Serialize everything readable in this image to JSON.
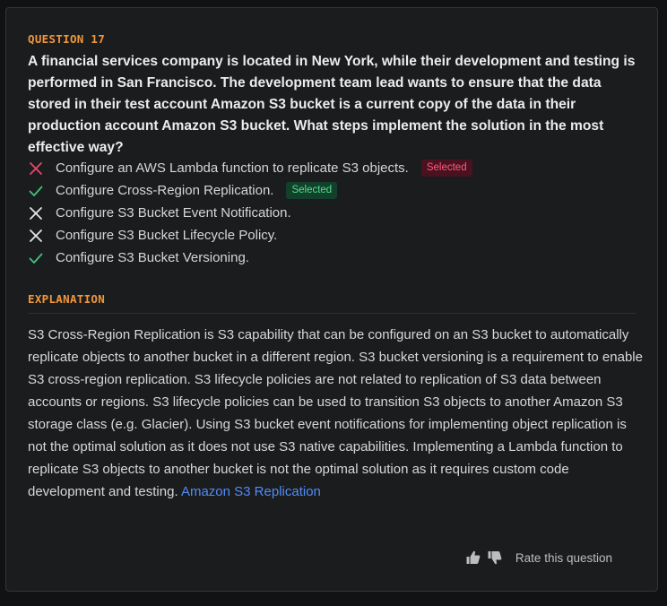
{
  "question": {
    "label": "QUESTION 17",
    "text": "A financial services company is located in New York, while their development and testing is performed in San Francisco. The development team lead wants to ensure that the data stored in their test account Amazon S3 bucket is a current copy of the data in their production account Amazon S3 bucket. What steps implement the solution in the most effective way?"
  },
  "answers": [
    {
      "text": "Configure an AWS Lambda function to replicate S3 objects.",
      "mark": "x-icon",
      "mark_color": "#e5486b",
      "badge": "Selected",
      "badge_type": "wrong"
    },
    {
      "text": "Configure Cross-Region Replication.",
      "mark": "check-icon",
      "mark_color": "#3ec77a",
      "badge": "Selected",
      "badge_type": "right"
    },
    {
      "text": "Configure S3 Bucket Event Notification.",
      "mark": "x-icon",
      "mark_color": "#e6e6e6",
      "badge": "",
      "badge_type": ""
    },
    {
      "text": "Configure S3 Bucket Lifecycle Policy.",
      "mark": "x-icon",
      "mark_color": "#e6e6e6",
      "badge": "",
      "badge_type": ""
    },
    {
      "text": "Configure S3 Bucket Versioning.",
      "mark": "check-icon",
      "mark_color": "#3ec77a",
      "badge": "",
      "badge_type": ""
    }
  ],
  "explanation": {
    "label": "EXPLANATION",
    "text": "S3 Cross-Region Replication is S3 capability that can be configured on an S3 bucket to automatically replicate objects to another bucket in a different region. S3 bucket versioning is a requirement to enable S3 cross-region replication. S3 lifecycle policies are not related to replication of S3 data between accounts or regions. S3 lifecycle policies can be used to transition S3 objects to another Amazon S3 storage class (e.g. Glacier). Using S3 bucket event notifications for implementing object replication is not the optimal solution as it does not use S3 native capabilities. Implementing a Lambda function to replicate S3 objects to another bucket is not the optimal solution as it requires custom code development and testing.",
    "link_text": "Amazon S3 Replication"
  },
  "rating": {
    "label": "Rate this question",
    "up_icon": "thumbs-up-icon",
    "down_icon": "thumbs-down-icon"
  },
  "colors": {
    "accent_label": "#f0973c",
    "link": "#4f8cf7"
  }
}
